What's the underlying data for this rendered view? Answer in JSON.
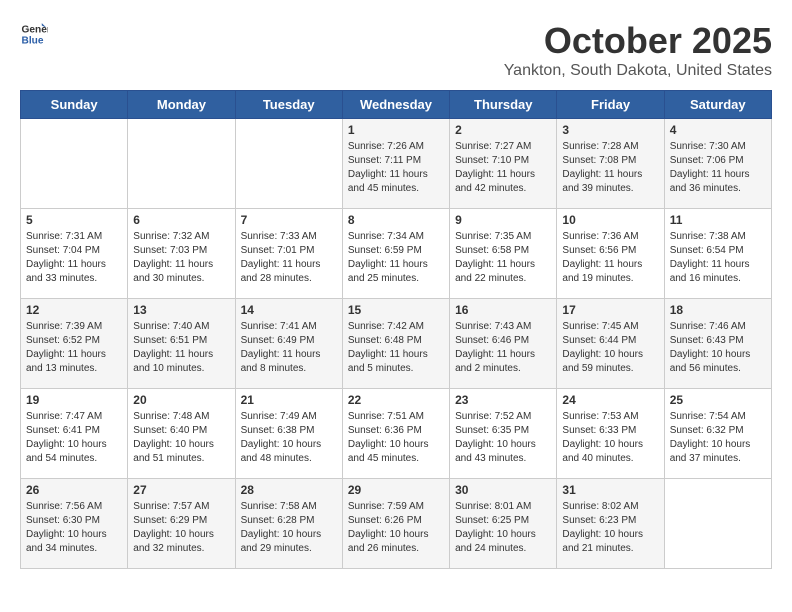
{
  "header": {
    "logo_line1": "General",
    "logo_line2": "Blue",
    "month": "October 2025",
    "location": "Yankton, South Dakota, United States"
  },
  "weekdays": [
    "Sunday",
    "Monday",
    "Tuesday",
    "Wednesday",
    "Thursday",
    "Friday",
    "Saturday"
  ],
  "weeks": [
    [
      {
        "day": "",
        "info": ""
      },
      {
        "day": "",
        "info": ""
      },
      {
        "day": "",
        "info": ""
      },
      {
        "day": "1",
        "info": "Sunrise: 7:26 AM\nSunset: 7:11 PM\nDaylight: 11 hours and 45 minutes."
      },
      {
        "day": "2",
        "info": "Sunrise: 7:27 AM\nSunset: 7:10 PM\nDaylight: 11 hours and 42 minutes."
      },
      {
        "day": "3",
        "info": "Sunrise: 7:28 AM\nSunset: 7:08 PM\nDaylight: 11 hours and 39 minutes."
      },
      {
        "day": "4",
        "info": "Sunrise: 7:30 AM\nSunset: 7:06 PM\nDaylight: 11 hours and 36 minutes."
      }
    ],
    [
      {
        "day": "5",
        "info": "Sunrise: 7:31 AM\nSunset: 7:04 PM\nDaylight: 11 hours and 33 minutes."
      },
      {
        "day": "6",
        "info": "Sunrise: 7:32 AM\nSunset: 7:03 PM\nDaylight: 11 hours and 30 minutes."
      },
      {
        "day": "7",
        "info": "Sunrise: 7:33 AM\nSunset: 7:01 PM\nDaylight: 11 hours and 28 minutes."
      },
      {
        "day": "8",
        "info": "Sunrise: 7:34 AM\nSunset: 6:59 PM\nDaylight: 11 hours and 25 minutes."
      },
      {
        "day": "9",
        "info": "Sunrise: 7:35 AM\nSunset: 6:58 PM\nDaylight: 11 hours and 22 minutes."
      },
      {
        "day": "10",
        "info": "Sunrise: 7:36 AM\nSunset: 6:56 PM\nDaylight: 11 hours and 19 minutes."
      },
      {
        "day": "11",
        "info": "Sunrise: 7:38 AM\nSunset: 6:54 PM\nDaylight: 11 hours and 16 minutes."
      }
    ],
    [
      {
        "day": "12",
        "info": "Sunrise: 7:39 AM\nSunset: 6:52 PM\nDaylight: 11 hours and 13 minutes."
      },
      {
        "day": "13",
        "info": "Sunrise: 7:40 AM\nSunset: 6:51 PM\nDaylight: 11 hours and 10 minutes."
      },
      {
        "day": "14",
        "info": "Sunrise: 7:41 AM\nSunset: 6:49 PM\nDaylight: 11 hours and 8 minutes."
      },
      {
        "day": "15",
        "info": "Sunrise: 7:42 AM\nSunset: 6:48 PM\nDaylight: 11 hours and 5 minutes."
      },
      {
        "day": "16",
        "info": "Sunrise: 7:43 AM\nSunset: 6:46 PM\nDaylight: 11 hours and 2 minutes."
      },
      {
        "day": "17",
        "info": "Sunrise: 7:45 AM\nSunset: 6:44 PM\nDaylight: 10 hours and 59 minutes."
      },
      {
        "day": "18",
        "info": "Sunrise: 7:46 AM\nSunset: 6:43 PM\nDaylight: 10 hours and 56 minutes."
      }
    ],
    [
      {
        "day": "19",
        "info": "Sunrise: 7:47 AM\nSunset: 6:41 PM\nDaylight: 10 hours and 54 minutes."
      },
      {
        "day": "20",
        "info": "Sunrise: 7:48 AM\nSunset: 6:40 PM\nDaylight: 10 hours and 51 minutes."
      },
      {
        "day": "21",
        "info": "Sunrise: 7:49 AM\nSunset: 6:38 PM\nDaylight: 10 hours and 48 minutes."
      },
      {
        "day": "22",
        "info": "Sunrise: 7:51 AM\nSunset: 6:36 PM\nDaylight: 10 hours and 45 minutes."
      },
      {
        "day": "23",
        "info": "Sunrise: 7:52 AM\nSunset: 6:35 PM\nDaylight: 10 hours and 43 minutes."
      },
      {
        "day": "24",
        "info": "Sunrise: 7:53 AM\nSunset: 6:33 PM\nDaylight: 10 hours and 40 minutes."
      },
      {
        "day": "25",
        "info": "Sunrise: 7:54 AM\nSunset: 6:32 PM\nDaylight: 10 hours and 37 minutes."
      }
    ],
    [
      {
        "day": "26",
        "info": "Sunrise: 7:56 AM\nSunset: 6:30 PM\nDaylight: 10 hours and 34 minutes."
      },
      {
        "day": "27",
        "info": "Sunrise: 7:57 AM\nSunset: 6:29 PM\nDaylight: 10 hours and 32 minutes."
      },
      {
        "day": "28",
        "info": "Sunrise: 7:58 AM\nSunset: 6:28 PM\nDaylight: 10 hours and 29 minutes."
      },
      {
        "day": "29",
        "info": "Sunrise: 7:59 AM\nSunset: 6:26 PM\nDaylight: 10 hours and 26 minutes."
      },
      {
        "day": "30",
        "info": "Sunrise: 8:01 AM\nSunset: 6:25 PM\nDaylight: 10 hours and 24 minutes."
      },
      {
        "day": "31",
        "info": "Sunrise: 8:02 AM\nSunset: 6:23 PM\nDaylight: 10 hours and 21 minutes."
      },
      {
        "day": "",
        "info": ""
      }
    ]
  ]
}
